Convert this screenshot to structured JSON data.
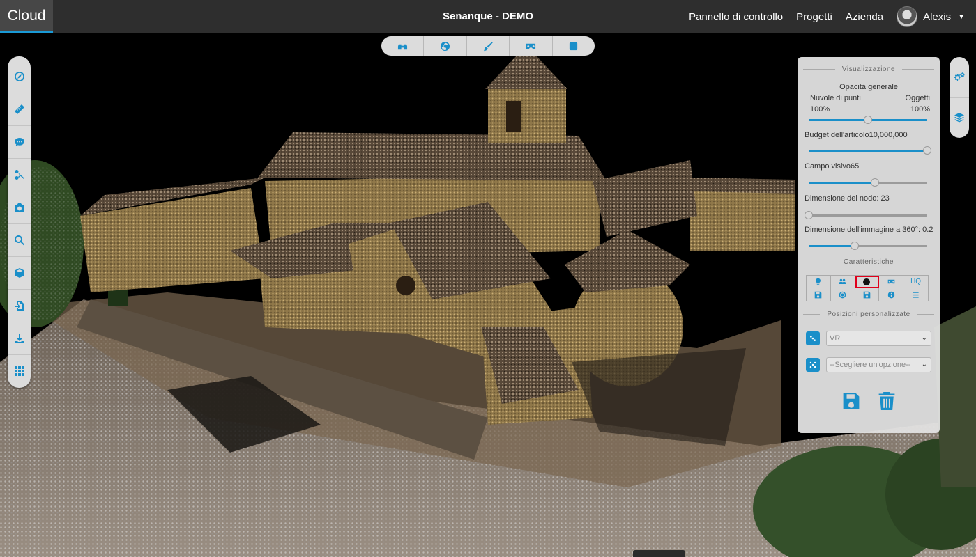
{
  "navbar": {
    "brand": "Cloud",
    "project_title": "Senanque - DEMO",
    "links": [
      "Pannello di controllo",
      "Progetti",
      "Azienda"
    ],
    "user_name": "Alexis",
    "accent_color": "#1a9ad6"
  },
  "top_toolbar": {
    "icons": [
      "binoculars-icon",
      "globe-icon",
      "brush-icon",
      "vr-headset-icon",
      "square-icon"
    ]
  },
  "left_toolbar": {
    "icons": [
      "compass-icon",
      "ruler-icon",
      "comment-icon",
      "scissors-icon",
      "camera-icon",
      "search-icon",
      "cube-icon",
      "file-import-icon",
      "download-icon",
      "grid-icon"
    ]
  },
  "right_toolbar": {
    "icons": [
      "cogs-icon",
      "layers-icon"
    ]
  },
  "panel": {
    "visualization_title": "Visualizzazione",
    "opacity_title": "Opacità generale",
    "point_clouds_label": "Nuvole di punti",
    "objects_label": "Oggetti",
    "point_clouds_value": "100%",
    "objects_value": "100%",
    "opacity_slider_fraction": 0.5,
    "budget_label": "Budget dell'articolo10,000,000",
    "budget_slider_fraction": 1.0,
    "fov_label": "Campo visivo65",
    "fov_slider_fraction": 0.56,
    "node_size_label": "Dimensione del nodo: 23",
    "node_size_slider_fraction": 0.0,
    "image360_label": "Dimensione dell'immagine a 360°: 0.2",
    "image360_slider_fraction": 0.39,
    "features_title": "Caratteristiche",
    "features": [
      {
        "icon": "lightbulb-icon",
        "label": ""
      },
      {
        "icon": "users-icon",
        "label": ""
      },
      {
        "icon": "circle-icon",
        "label": "",
        "selected": true
      },
      {
        "icon": "vr-headset-icon",
        "label": ""
      },
      {
        "icon": "",
        "label": "HQ"
      },
      {
        "icon": "save-icon",
        "label": ""
      },
      {
        "icon": "target-icon",
        "label": ""
      },
      {
        "icon": "save-icon",
        "label": ""
      },
      {
        "icon": "info-icon",
        "label": ""
      },
      {
        "icon": "list-icon",
        "label": ""
      }
    ],
    "positions_title": "Posizioni personalizzate",
    "position_select_1": "VR",
    "position_select_2": "--Scegliere un'opzione--"
  }
}
